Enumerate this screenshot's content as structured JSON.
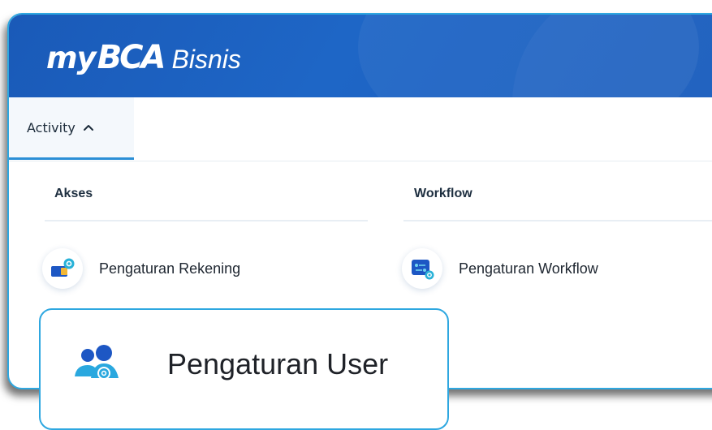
{
  "header": {
    "logo_my": "my",
    "logo_bca": "BCA",
    "logo_bisnis": "Bisnis",
    "color": "#1a5cbd"
  },
  "tabs": {
    "activity_label": "Activity"
  },
  "columns": {
    "akses": {
      "title": "Akses",
      "items": [
        {
          "label": "Pengaturan Rekening",
          "icon": "account-settings-icon"
        }
      ]
    },
    "workflow": {
      "title": "Workflow",
      "items": [
        {
          "label": "Pengaturan Workflow",
          "icon": "workflow-settings-icon"
        }
      ]
    }
  },
  "callout": {
    "label": "Pengaturan User",
    "icon": "user-settings-icon"
  },
  "colors": {
    "accent": "#2ea7e0",
    "brand": "#1a5cbd"
  }
}
